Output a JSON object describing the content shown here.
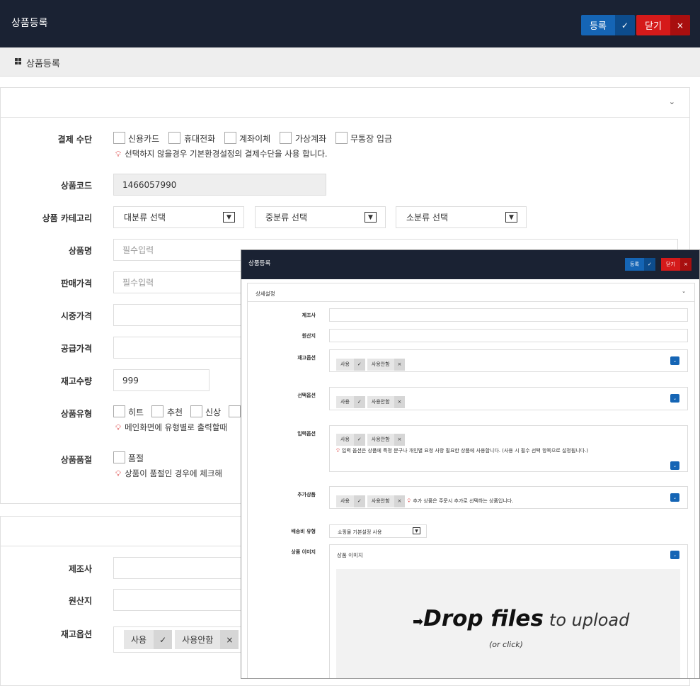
{
  "header": {
    "title": "상품등록",
    "register_label": "등록",
    "register_icon": "✓",
    "close_label": "닫기",
    "close_icon": "×"
  },
  "breadcrumb": {
    "title": "상품등록"
  },
  "form": {
    "payment": {
      "label": "결제 수단",
      "options": [
        "신용카드",
        "휴대전화",
        "계좌이체",
        "가상계좌",
        "무통장 입금"
      ],
      "hint": "선택하지 않을경우 기본환경설정의 결제수단을 사용 합니다."
    },
    "code": {
      "label": "상품코드",
      "value": "1466057990"
    },
    "category": {
      "label": "상품 카테고리",
      "major": "대분류 선택",
      "middle": "중분류 선택",
      "minor": "소분류 선택"
    },
    "name": {
      "label": "상품명",
      "placeholder": "필수입력"
    },
    "price": {
      "label": "판매가격",
      "placeholder": "필수입력"
    },
    "market_price": {
      "label": "시중가격"
    },
    "supply_price": {
      "label": "공급가격"
    },
    "stock": {
      "label": "재고수량",
      "value": "999"
    },
    "type": {
      "label": "상품유형",
      "options": [
        "히트",
        "추천",
        "신상"
      ],
      "hint": "메인화면에 유형별로 출력할때"
    },
    "soldout": {
      "label": "상품품절",
      "option": "품절",
      "hint": "상품이 품절인 경우에 체크해"
    }
  },
  "form2": {
    "maker": {
      "label": "제조사"
    },
    "origin": {
      "label": "원산지"
    },
    "stock_option": {
      "label": "재고옵션",
      "use": "사용",
      "use_icon": "✓",
      "nouse": "사용안함",
      "nouse_icon": "×"
    }
  },
  "overlay": {
    "title": "상품등록",
    "register_label": "등록",
    "register_icon": "✓",
    "close_label": "닫기",
    "close_icon": "×",
    "section_title": "상세설정",
    "maker": "제조사",
    "origin": "원산지",
    "stock_option": "재고옵션",
    "select_option": "선택옵션",
    "input_option": "입력옵션",
    "extra_product": "추가상품",
    "use": "사용",
    "use_icon": "✓",
    "nouse": "사용안함",
    "nouse_icon": "×",
    "input_hint": "입력 옵션은 상품에 특정 문구나 개인별 요청 사항 필요한 상품에 사용합니다. (사용 시 필수 선택 항목으로 설정됩니다.)",
    "extra_hint": "추가 상품은 주문시 추가로 선택하는 상품입니다.",
    "shipping_label": "배송비 유형",
    "shipping_value": "쇼핑몰 기본설정 사용",
    "image_label": "상품 이미지",
    "image_title": "상품 이미지",
    "drop_main": "Drop files",
    "drop_tail": "to upload",
    "drop_sub": "(or click)"
  }
}
